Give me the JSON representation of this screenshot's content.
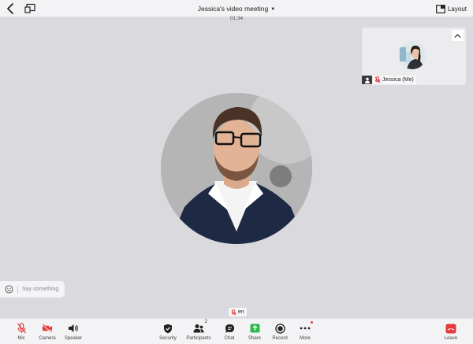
{
  "header": {
    "title": "Jessica's video meeting",
    "timer": "01:34",
    "layout_label": "Layout"
  },
  "thumbnail": {
    "name": "Jessica (Me)"
  },
  "chat": {
    "placeholder": "Say something"
  },
  "language": {
    "code": "en"
  },
  "toolbar": {
    "left": [
      {
        "label": "Mic",
        "icon": "mic-muted-icon"
      },
      {
        "label": "Camera",
        "icon": "camera-off-icon"
      },
      {
        "label": "Speaker",
        "icon": "speaker-icon"
      }
    ],
    "center": [
      {
        "label": "Security",
        "icon": "shield-icon"
      },
      {
        "label": "Participants",
        "icon": "participants-icon",
        "count": "2"
      },
      {
        "label": "Chat",
        "icon": "chat-icon"
      },
      {
        "label": "Share",
        "icon": "share-icon"
      },
      {
        "label": "Record",
        "icon": "record-icon"
      },
      {
        "label": "More",
        "icon": "more-icon"
      }
    ],
    "right": [
      {
        "label": "Leave",
        "icon": "leave-icon"
      }
    ]
  },
  "colors": {
    "muted_red": "#e03a3a",
    "share_green": "#2db84d",
    "leave_red": "#e5383b"
  }
}
